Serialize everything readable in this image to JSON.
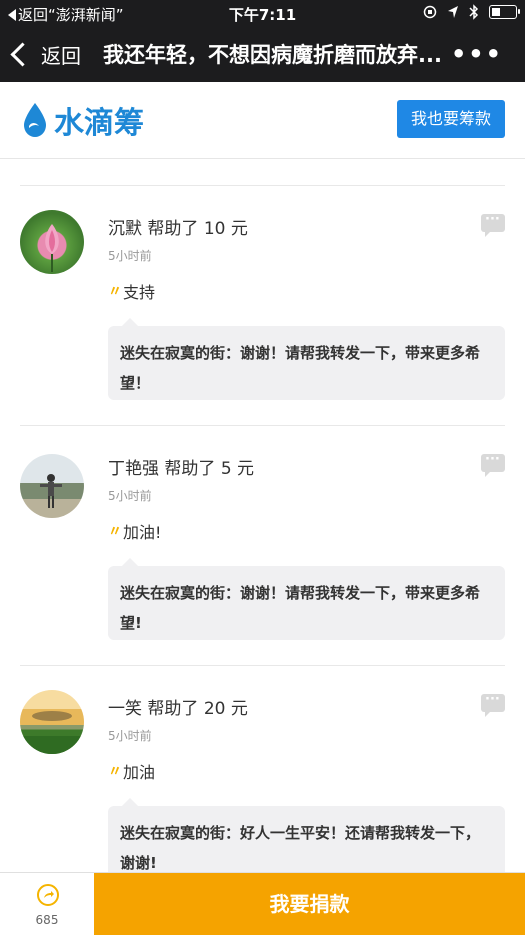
{
  "status_bar": {
    "back_app": "返回“澎湃新闻”",
    "time": "下午7:11"
  },
  "nav": {
    "back_label": "返回",
    "title": "我还年轻，不想因病魔折磨而放弃...",
    "more_label": "•••"
  },
  "brand": {
    "logo_text": "水滴筹",
    "raise_button": "我也要筹款",
    "brand_color": "#1e88d6"
  },
  "donations": [
    {
      "donor": "沉默",
      "action": "帮助了",
      "amount": "10 元",
      "time": "5小时前",
      "message": "支持",
      "reply_author": "迷失在寂寞的街：",
      "reply_text": "谢谢！请帮我转发一下，带来更多希望！"
    },
    {
      "donor": "丁艳强",
      "action": "帮助了",
      "amount": "5 元",
      "time": "5小时前",
      "message": "加油!",
      "reply_author": "迷失在寂寞的街：",
      "reply_text": "谢谢！请帮我转发一下，带来更多希望!"
    },
    {
      "donor": "一笑",
      "action": "帮助了",
      "amount": "20 元",
      "time": "5小时前",
      "message": "加油",
      "reply_author": "迷失在寂寞的街：",
      "reply_text": "好人一生平安！还请帮我转发一下，谢谢!"
    }
  ],
  "bottom": {
    "share_count": "685",
    "donate_button": "我要捐款",
    "donate_color": "#f5a300"
  }
}
